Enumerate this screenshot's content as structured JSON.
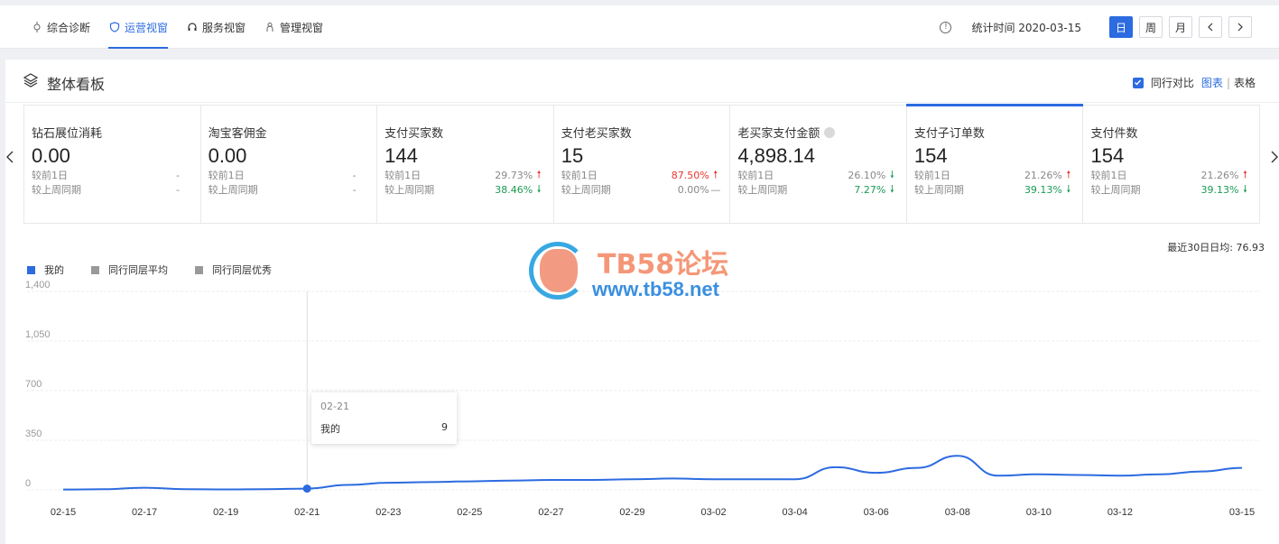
{
  "nav": {
    "tabs": [
      {
        "label": "综合诊断",
        "icon": "diagnosis-icon"
      },
      {
        "label": "运营视窗",
        "icon": "shield-icon",
        "active": true
      },
      {
        "label": "服务视窗",
        "icon": "headset-icon"
      },
      {
        "label": "管理视窗",
        "icon": "manage-icon"
      }
    ],
    "stat_time_label": "统计时间 2020-03-15",
    "period_buttons": [
      "日",
      "周",
      "月"
    ],
    "active_period": "日",
    "info_icon": "!"
  },
  "board": {
    "title": "整体看板",
    "compare_label": "同行对比",
    "view_chart": "图表",
    "view_sep": "|",
    "view_table": "表格"
  },
  "metrics": [
    {
      "label": "钻石展位消耗",
      "value": "0.00",
      "day_label": "较前1日",
      "day_val": "-",
      "day_dir": "",
      "week_label": "较上周同期",
      "week_val": "-",
      "week_dir": ""
    },
    {
      "label": "淘宝客佣金",
      "value": "0.00",
      "day_label": "较前1日",
      "day_val": "-",
      "day_dir": "",
      "week_label": "较上周同期",
      "week_val": "-",
      "week_dir": ""
    },
    {
      "label": "支付买家数",
      "value": "144",
      "day_label": "较前1日",
      "day_val": "29.73%",
      "day_dir": "up",
      "week_label": "较上周同期",
      "week_val": "38.46%",
      "week_dir": "down"
    },
    {
      "label": "支付老买家数",
      "value": "15",
      "day_label": "较前1日",
      "day_val": "87.50%",
      "day_dir": "up-red",
      "week_label": "较上周同期",
      "week_val": "0.00%",
      "week_dir": "flat"
    },
    {
      "label": "老买家支付金额",
      "value": "4,898.14",
      "day_label": "较前1日",
      "day_val": "26.10%",
      "day_dir": "down",
      "week_label": "较上周同期",
      "week_val": "7.27%",
      "week_dir": "down",
      "has_hint": true
    },
    {
      "label": "支付子订单数",
      "value": "154",
      "day_label": "较前1日",
      "day_val": "21.26%",
      "day_dir": "up",
      "week_label": "较上周同期",
      "week_val": "39.13%",
      "week_dir": "down",
      "selected": true
    },
    {
      "label": "支付件数",
      "value": "154",
      "day_label": "较前1日",
      "day_val": "21.26%",
      "day_dir": "up",
      "week_label": "较上周同期",
      "week_val": "39.13%",
      "week_dir": "down"
    }
  ],
  "avg_label": "最近30日日均: 76.93",
  "legend": [
    {
      "name": "我的",
      "color": "#2c6be0"
    },
    {
      "name": "同行同层平均",
      "color": "#999999"
    },
    {
      "name": "同行同层优秀",
      "color": "#999999"
    }
  ],
  "tooltip": {
    "date": "02-21",
    "series": "我的",
    "value": "9"
  },
  "watermark": {
    "line1": "TB58论坛",
    "line2": "www.tb58.net"
  },
  "chart_data": {
    "type": "line",
    "ylim": [
      0,
      1400
    ],
    "yticks": [
      "1,400",
      "1,050",
      "700",
      "350",
      "0"
    ],
    "yticks_values": [
      1400,
      1050,
      700,
      350,
      0
    ],
    "x_labels": [
      "02-15",
      "02-17",
      "02-19",
      "02-21",
      "02-23",
      "02-25",
      "02-27",
      "02-29",
      "03-02",
      "03-04",
      "03-06",
      "03-08",
      "03-10",
      "03-12",
      "03-15"
    ],
    "x": [
      "02-15",
      "02-16",
      "02-17",
      "02-18",
      "02-19",
      "02-20",
      "02-21",
      "02-22",
      "02-23",
      "02-24",
      "02-25",
      "02-26",
      "02-27",
      "02-28",
      "02-29",
      "03-01",
      "03-02",
      "03-03",
      "03-04",
      "03-05",
      "03-06",
      "03-07",
      "03-08",
      "03-09",
      "03-10",
      "03-11",
      "03-12",
      "03-13",
      "03-14",
      "03-15"
    ],
    "series": [
      {
        "name": "我的",
        "color": "#2c6be0",
        "values": [
          2,
          5,
          15,
          5,
          3,
          5,
          9,
          35,
          50,
          55,
          60,
          65,
          70,
          70,
          75,
          80,
          75,
          75,
          75,
          160,
          120,
          155,
          240,
          100,
          110,
          105,
          100,
          110,
          130,
          155
        ]
      }
    ],
    "highlight_index": 6
  }
}
